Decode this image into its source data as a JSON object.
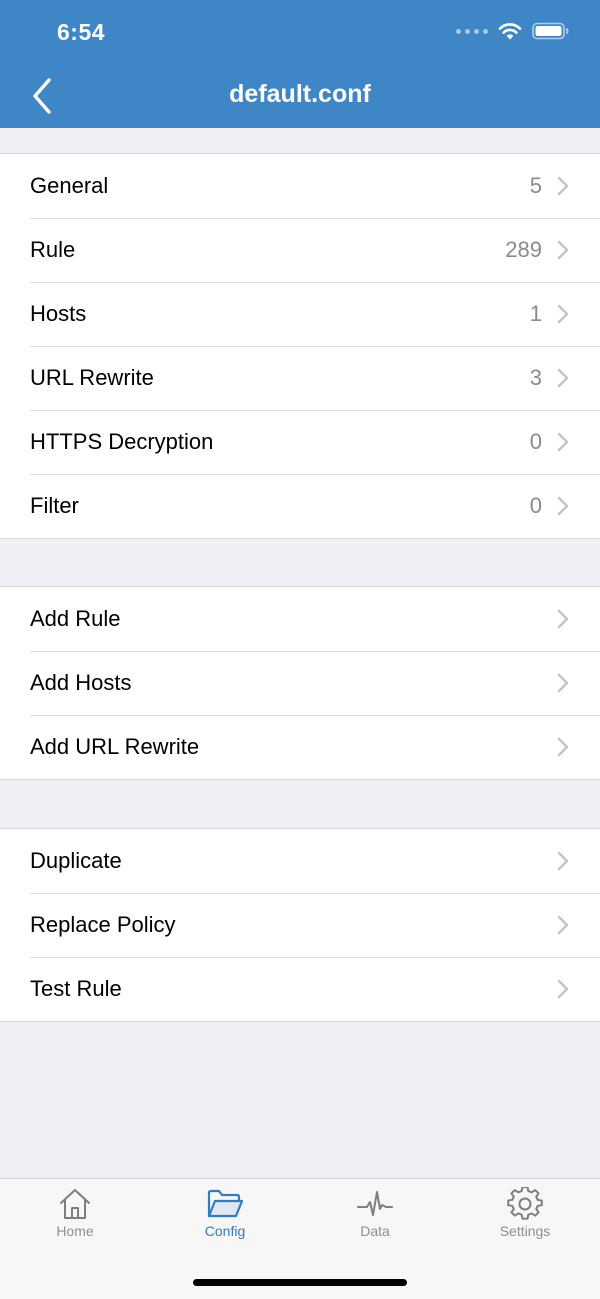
{
  "status": {
    "time": "6:54"
  },
  "header": {
    "title": "default.conf"
  },
  "groups": {
    "config_sections": [
      {
        "label": "General",
        "value": "5"
      },
      {
        "label": "Rule",
        "value": "289"
      },
      {
        "label": "Hosts",
        "value": "1"
      },
      {
        "label": "URL Rewrite",
        "value": "3"
      },
      {
        "label": "HTTPS Decryption",
        "value": "0"
      },
      {
        "label": "Filter",
        "value": "0"
      }
    ],
    "add_actions": [
      {
        "label": "Add Rule"
      },
      {
        "label": "Add Hosts"
      },
      {
        "label": "Add URL Rewrite"
      }
    ],
    "tools": [
      {
        "label": "Duplicate"
      },
      {
        "label": "Replace Policy"
      },
      {
        "label": "Test Rule"
      }
    ]
  },
  "tabbar": {
    "tabs": [
      {
        "label": "Home",
        "icon": "house-icon",
        "active": false
      },
      {
        "label": "Config",
        "icon": "folder-icon",
        "active": true
      },
      {
        "label": "Data",
        "icon": "pulse-icon",
        "active": false
      },
      {
        "label": "Settings",
        "icon": "gear-icon",
        "active": false
      }
    ]
  },
  "colors": {
    "header": "#3f86c7",
    "accent": "#2f7bc7",
    "background": "#efeff4",
    "value_text": "#8a8a8f"
  }
}
